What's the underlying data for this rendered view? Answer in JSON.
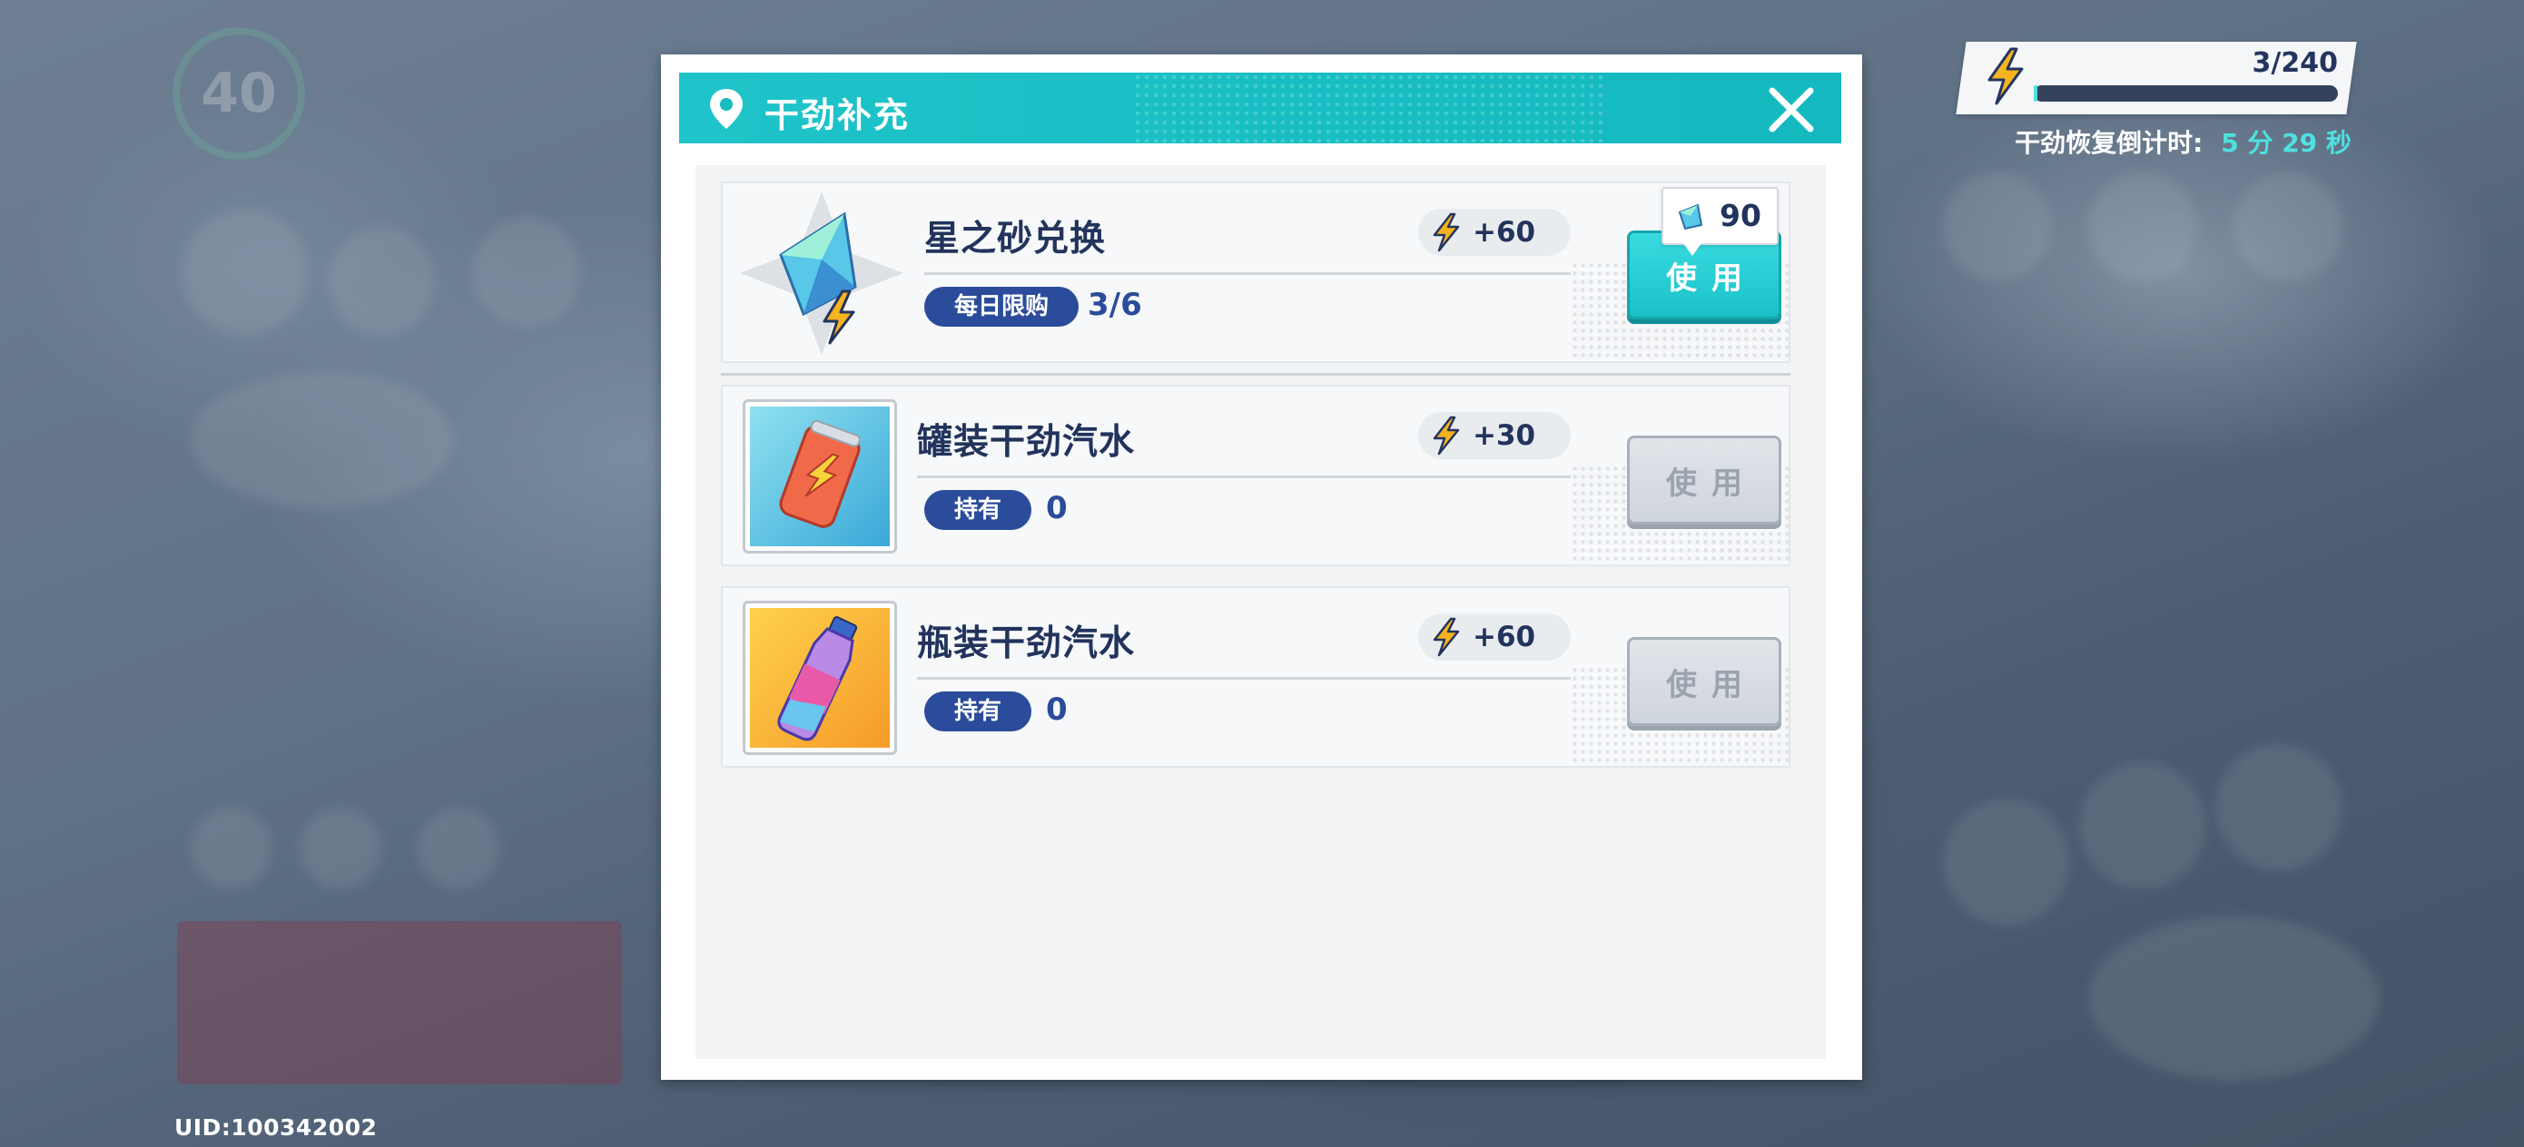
{
  "background": {
    "level": "40",
    "uid": "UID:100342002"
  },
  "energy": {
    "value": "3/240",
    "recover_label": "干劲恢复倒计时:",
    "recover_time": "5 分 29 秒",
    "fill_fraction": 0.0125
  },
  "modal": {
    "title": "干劲补充",
    "items": [
      {
        "name": "星之砂兑换",
        "gain": "+60",
        "tag": "每日限购",
        "count": "3/6",
        "cost": "90",
        "button": "使用",
        "button_enabled": true
      },
      {
        "name": "罐装干劲汽水",
        "gain": "+30",
        "tag": "持有",
        "count": "0",
        "button": "使用",
        "button_enabled": false
      },
      {
        "name": "瓶装干劲汽水",
        "gain": "+60",
        "tag": "持有",
        "count": "0",
        "button": "使用",
        "button_enabled": false
      }
    ]
  },
  "colors": {
    "header_teal": "#1ec4c9",
    "title_navy": "#22335c",
    "tag_blue": "#2b4c9a",
    "bolt_yellow": "#f5b31f",
    "timer_cyan": "#4fe0e0"
  },
  "icons": [
    "location-pin-icon",
    "close-icon",
    "lightning-bolt-icon",
    "star-sand-crystal-icon",
    "soda-can-icon",
    "soda-bottle-icon",
    "gem-currency-icon"
  ]
}
